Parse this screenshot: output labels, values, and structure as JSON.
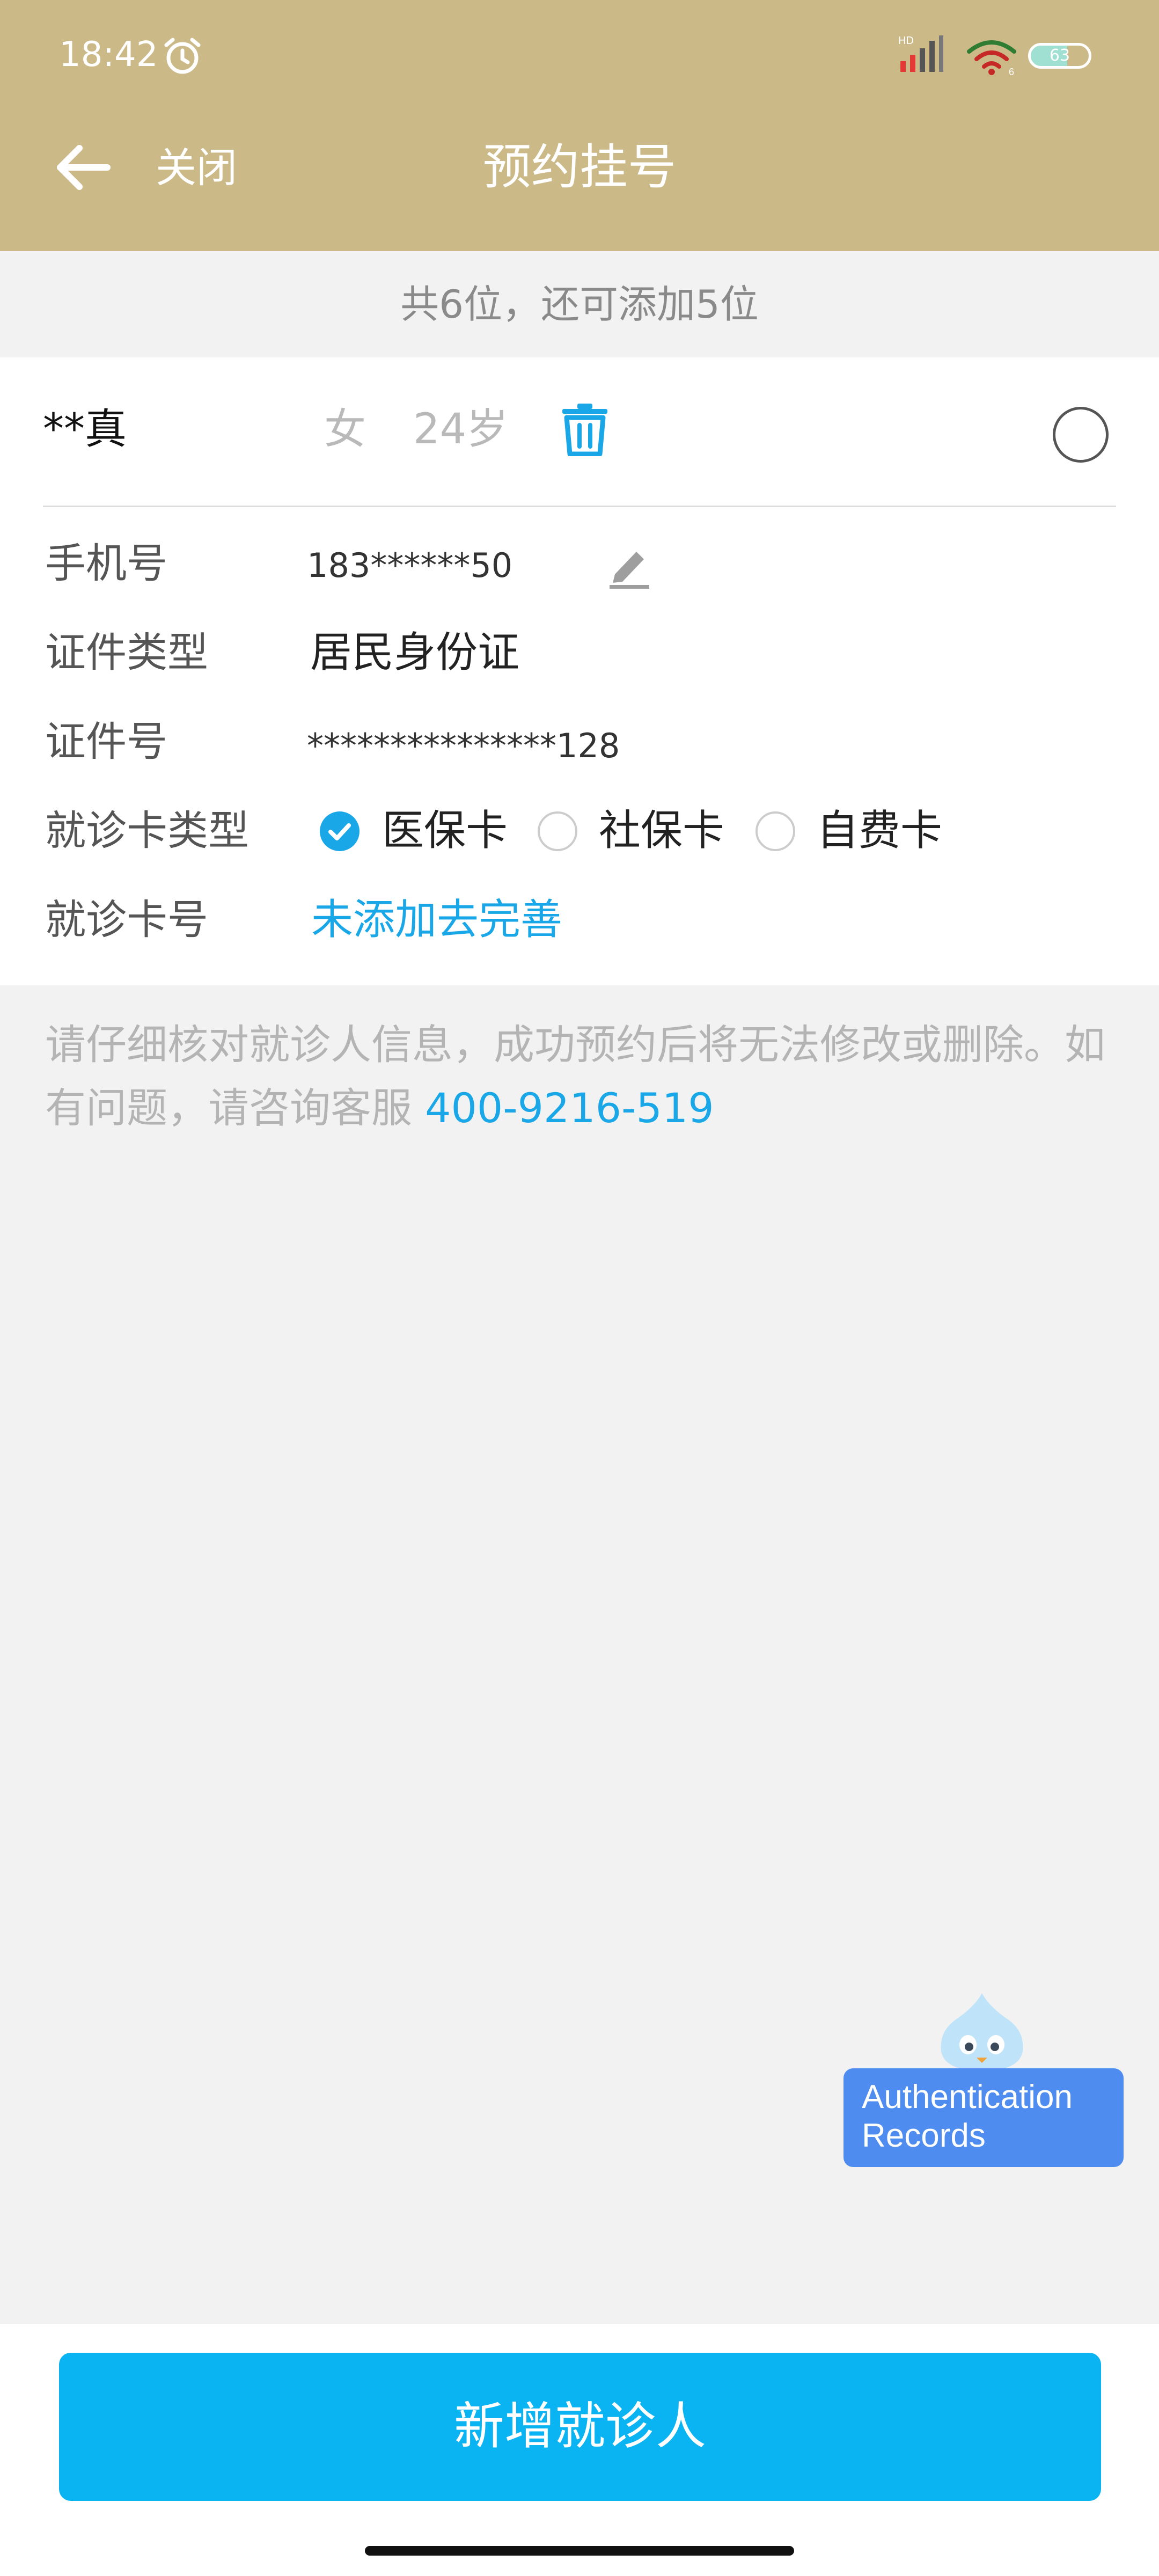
{
  "status_bar": {
    "time": "18:42",
    "battery_level": "63",
    "battery_fraction": 0.63,
    "signal_label": "HD",
    "wifi_label": "6",
    "icons": [
      "alarm-icon",
      "signal-icon",
      "wifi-icon",
      "battery-icon"
    ]
  },
  "nav": {
    "back_icon": "arrow-left-icon",
    "close_label": "关闭",
    "title": "预约挂号"
  },
  "summary": {
    "text": "共6位，还可添加5位"
  },
  "patient": {
    "name": "**真",
    "gender": "女",
    "age": "24岁",
    "fields": {
      "phone_label": "手机号",
      "phone_value": "183******50",
      "id_type_label": "证件类型",
      "id_type_value": "居民身份证",
      "id_number_label": "证件号",
      "id_number_value": "***************128",
      "card_type_label": "就诊卡类型",
      "card_types": [
        {
          "label": "医保卡",
          "selected": true
        },
        {
          "label": "社保卡",
          "selected": false
        },
        {
          "label": "自费卡",
          "selected": false
        }
      ],
      "card_number_label": "就诊卡号",
      "card_number_link": "未添加去完善"
    }
  },
  "notice": {
    "text": "请仔细核对就诊人信息，成功预约后将无法修改或删除。如有问题，请咨询客服 ",
    "phone": "400-9216-519"
  },
  "widget": {
    "line1": "Authentication",
    "line2": "Records"
  },
  "actions": {
    "add_patient": "新增就诊人"
  },
  "colors": {
    "header": "#cbb988",
    "accent": "#1aa7e8",
    "button": "#0ab4f2",
    "widget": "#4f8cf0"
  }
}
